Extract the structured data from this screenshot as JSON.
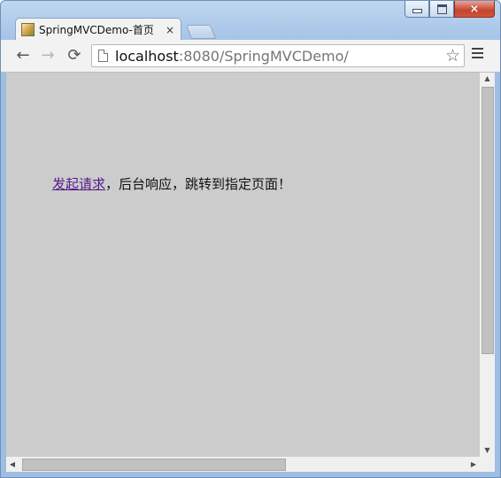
{
  "window": {
    "controls": {
      "minimize": "minimize",
      "maximize": "maximize",
      "close": "×"
    }
  },
  "tabs": [
    {
      "title": "SpringMVCDemo-首页",
      "close_glyph": "×"
    }
  ],
  "toolbar": {
    "back_glyph": "←",
    "forward_glyph": "→",
    "reload_glyph": "⟳",
    "url_host": "localhost",
    "url_rest": ":8080/SpringMVCDemo/",
    "bookmark_glyph": "☆"
  },
  "page": {
    "link_text": "发起请求",
    "message": "，后台响应，跳转到指定页面！"
  },
  "scrollbars": {
    "up": "▲",
    "down": "▼",
    "left": "◀",
    "right": "▶"
  },
  "colors": {
    "page_background": "#cccccc",
    "visited_link": "#551a8b"
  }
}
